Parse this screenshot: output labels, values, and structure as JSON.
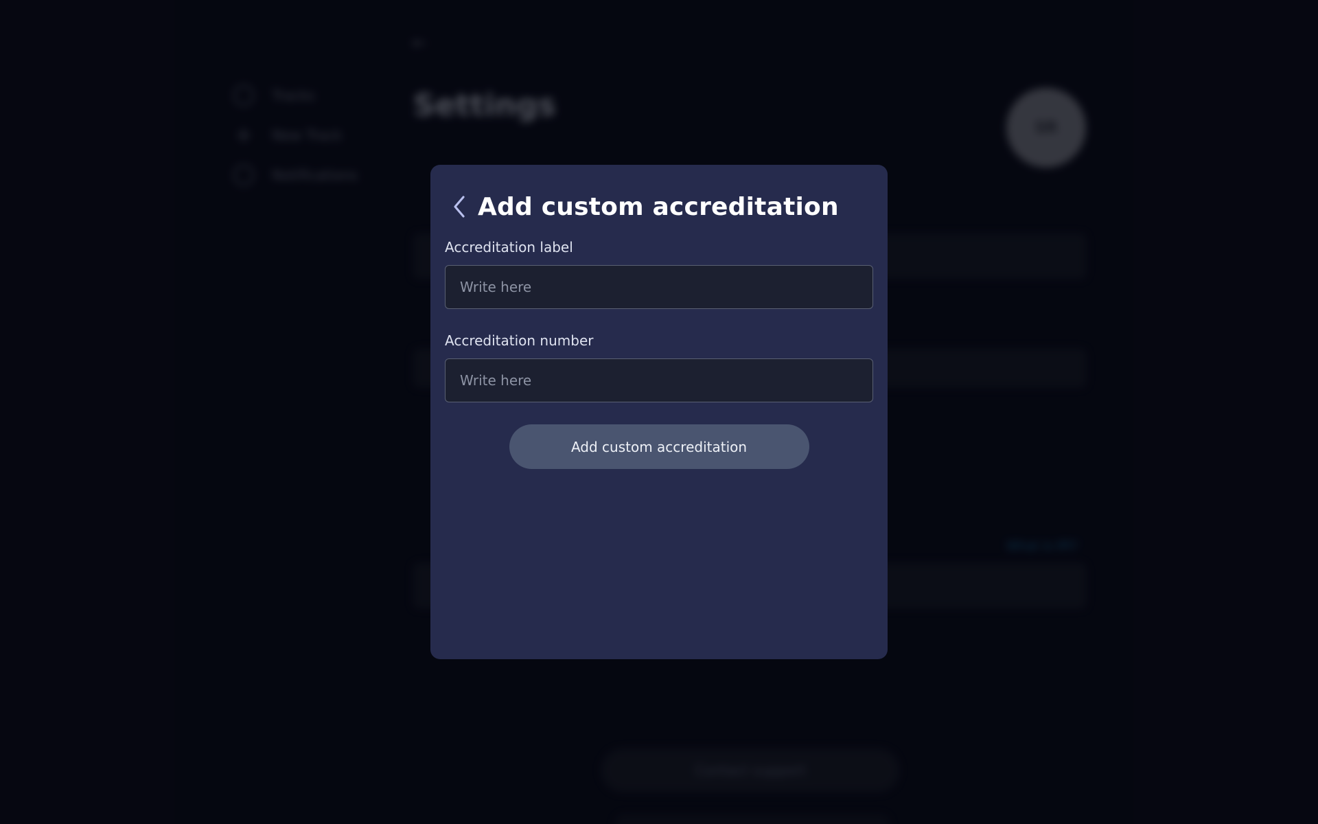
{
  "background": {
    "sidebar": {
      "items": [
        {
          "label": "Tracks",
          "icon": "tracks-icon"
        },
        {
          "label": "New Track",
          "icon": "plus-icon"
        },
        {
          "label": "Notifications",
          "icon": "bell-icon"
        }
      ]
    },
    "page_title": "Settings",
    "avatar_initials": "SR",
    "what_link": "What is IPI?",
    "support_button": "Contact support"
  },
  "modal": {
    "title": "Add custom accreditation",
    "back_icon": "chevron-left-icon",
    "fields": [
      {
        "label": "Accreditation label",
        "placeholder": "Write here",
        "value": ""
      },
      {
        "label": "Accreditation number",
        "placeholder": "Write here",
        "value": ""
      }
    ],
    "submit_label": "Add custom accreditation"
  },
  "colors": {
    "page_bg": "#070812",
    "modal_bg": "#262b4d",
    "input_bg": "#1c2030",
    "button_bg": "#4a5570",
    "link": "#1d7fb8"
  }
}
